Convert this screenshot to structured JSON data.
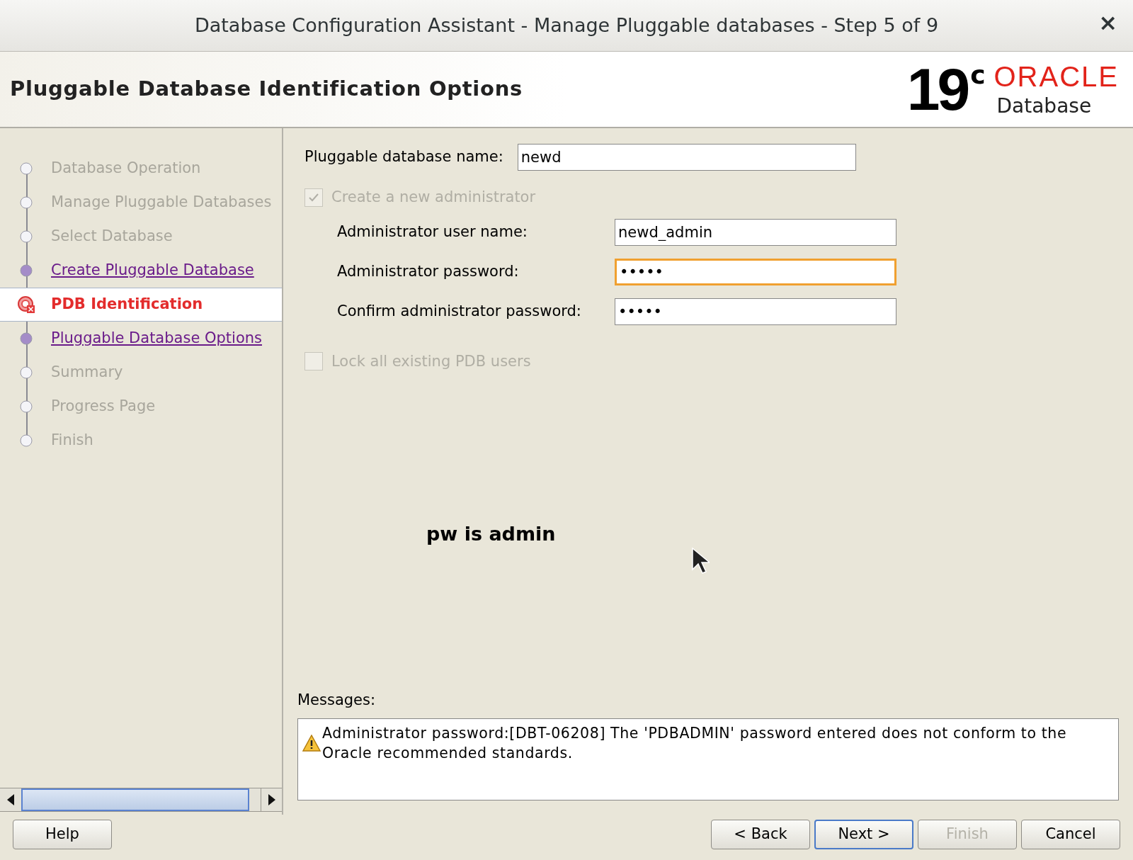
{
  "window": {
    "title": "Database Configuration Assistant - Manage Pluggable databases - Step 5 of 9",
    "close": "×"
  },
  "header": {
    "title": "Pluggable Database Identification Options",
    "logo": {
      "version": "19",
      "suffix": "c",
      "brand": "ORACLE",
      "product": "Database"
    }
  },
  "steps": [
    {
      "label": "Database Operation",
      "kind": "done",
      "selected": false
    },
    {
      "label": "Manage Pluggable Databases",
      "kind": "done",
      "selected": false
    },
    {
      "label": "Select Database",
      "kind": "done",
      "selected": false
    },
    {
      "label": "Create Pluggable Database",
      "kind": "link",
      "selected": false
    },
    {
      "label": "PDB Identification",
      "kind": "current",
      "selected": true
    },
    {
      "label": "Pluggable Database Options",
      "kind": "link",
      "selected": false
    },
    {
      "label": "Summary",
      "kind": "done",
      "selected": false
    },
    {
      "label": "Progress Page",
      "kind": "done",
      "selected": false
    },
    {
      "label": "Finish",
      "kind": "done",
      "selected": false
    }
  ],
  "form": {
    "pdb_name": {
      "label": "Pluggable database name:",
      "value": "newd"
    },
    "create_admin": {
      "label": "Create a new administrator",
      "checked": true,
      "disabled": true
    },
    "admin_fields": [
      {
        "label": "Administrator user name:",
        "value": "newd_admin",
        "focused": false
      },
      {
        "label": "Administrator password:",
        "value": "•••••",
        "focused": true
      },
      {
        "label": "Confirm administrator password:",
        "value": "•••••",
        "focused": false
      }
    ],
    "lock_users": {
      "label": "Lock all existing PDB users",
      "checked": false,
      "disabled": true
    },
    "note": "pw is admin"
  },
  "messages": {
    "label": "Messages:",
    "items": [
      "Administrator password:[DBT-06208] The 'PDBADMIN' password entered does not conform to the Oracle recommended standards."
    ]
  },
  "buttons": [
    {
      "label": "Help",
      "disabled": false,
      "default": false
    },
    {
      "label": "< Back",
      "disabled": false,
      "default": false
    },
    {
      "label": "Next >",
      "disabled": false,
      "default": true
    },
    {
      "label": "Finish",
      "disabled": true,
      "default": false
    },
    {
      "label": "Cancel",
      "disabled": false,
      "default": false
    }
  ]
}
